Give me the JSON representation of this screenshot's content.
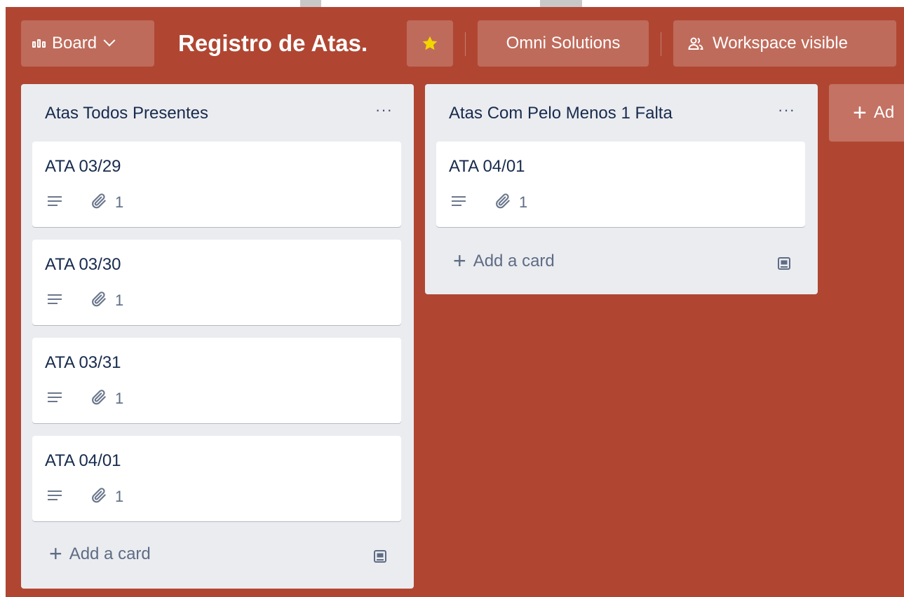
{
  "header": {
    "board_switcher_label": "Board",
    "board_title": "Registro de Atas.",
    "starred": true,
    "workspace_label": "Omni Solutions",
    "visibility_label": "Workspace visible"
  },
  "lists": [
    {
      "title": "Atas Todos Presentes",
      "cards": [
        {
          "title": "ATA 03/29",
          "attachments": "1"
        },
        {
          "title": "ATA 03/30",
          "attachments": "1"
        },
        {
          "title": "ATA 03/31",
          "attachments": "1"
        },
        {
          "title": "ATA 04/01",
          "attachments": "1"
        }
      ],
      "add_card_label": "Add a card"
    },
    {
      "title": "Atas Com Pelo Menos 1 Falta",
      "cards": [
        {
          "title": "ATA 04/01",
          "attachments": "1"
        }
      ],
      "add_card_label": "Add a card"
    }
  ],
  "add_list_label": "Ad",
  "colors": {
    "board_background": "#b04632",
    "list_background": "#ebecf0",
    "star": "#f2d600"
  },
  "icons": {
    "board": "board-grid-icon",
    "star": "star-icon",
    "visibility": "people-icon",
    "description": "description-icon",
    "attachment": "paperclip-icon",
    "template": "card-template-icon",
    "menu": "ellipsis-icon"
  }
}
